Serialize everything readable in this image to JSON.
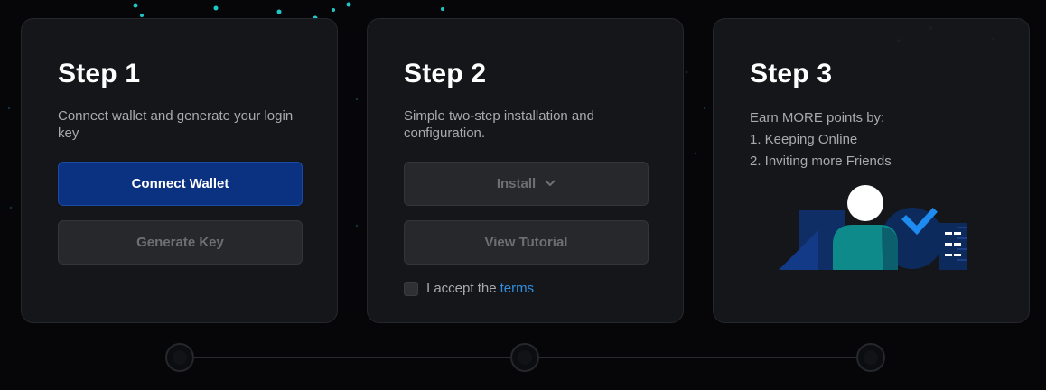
{
  "steps": [
    {
      "title": "Step 1",
      "description": "Connect wallet and generate your login key",
      "primary_button": "Connect Wallet",
      "secondary_button": "Generate Key"
    },
    {
      "title": "Step 2",
      "description": "Simple two-step installation and configuration.",
      "install_button": "Install",
      "tutorial_button": "View Tutorial",
      "terms_prefix": "I accept the",
      "terms_link": "terms"
    },
    {
      "title": "Step 3",
      "intro": "Earn MORE points by:",
      "items": [
        "1. Keeping Online",
        "2. Inviting more Friends"
      ]
    }
  ],
  "icons": {
    "install_dropdown": "chevron-down-icon",
    "illustration": "user-check-illustration"
  },
  "colors": {
    "primary_button": "#0b3280",
    "link": "#2f8fe0",
    "check": "#1d8bef",
    "teal": "#0f8a8a"
  }
}
